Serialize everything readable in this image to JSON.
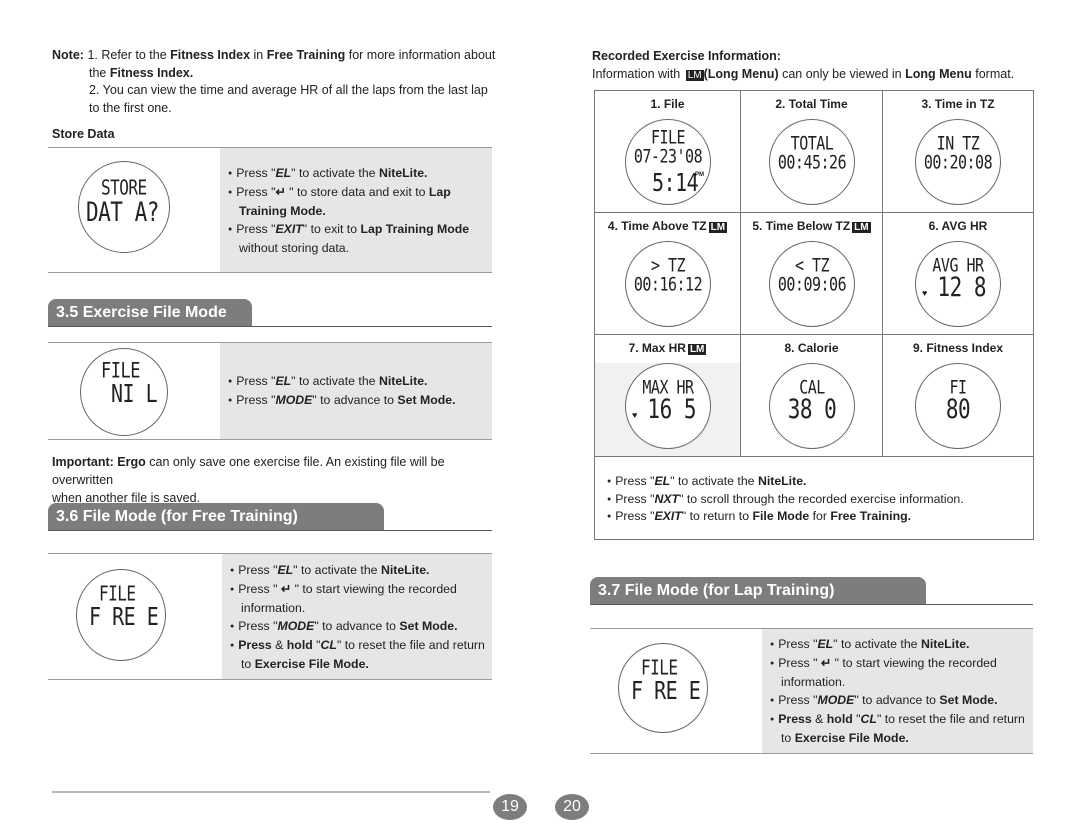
{
  "left_page": {
    "note": {
      "label": "Note:",
      "item1_prefix": "1. Refer to the",
      "item1_b1": "Fitness Index",
      "item1_mid": "in",
      "item1_b2": "Free Training",
      "item1_suffix": "for more information about",
      "item1_line2_pre": "the",
      "item1_line2_b": "Fitness Index.",
      "item2_line1": "2. You can view the time and average HR of all the laps from the last lap",
      "item2_line2": "to the first one."
    },
    "store_data": {
      "title": "Store Data",
      "watch": {
        "line1": "STORE",
        "line2": "DAT A?"
      },
      "bullets": [
        {
          "pre": "Press \"",
          "key": "EL",
          "mid": "\" to activate the ",
          "b": "NiteLite.",
          "post": ""
        },
        {
          "pre": "Press \"",
          "key": "↵",
          "mid": " \" to store data and exit to ",
          "b": "Lap",
          "post": ""
        },
        {
          "cont_b": "Training Mode."
        },
        {
          "pre": "Press \"",
          "key": "EXIT",
          "mid": "\" to exit to ",
          "b": "Lap Training Mode",
          "post": ""
        },
        {
          "cont": "without storing data."
        }
      ]
    },
    "section_35": {
      "title": "3.5 Exercise File Mode",
      "watch": {
        "line1": "FILE",
        "line2": "NI L"
      },
      "bullets": [
        {
          "pre": "Press \"",
          "key": "EL",
          "mid": "\" to activate the ",
          "b": "NiteLite."
        },
        {
          "pre": "Press \"",
          "key": "MODE",
          "mid": "\" to advance to ",
          "b": "Set Mode."
        }
      ]
    },
    "important": {
      "label": "Important:",
      "b": "Ergo",
      "text": "can only save one exercise file. An existing file will be overwritten",
      "line2": "when another file is saved."
    },
    "section_36": {
      "title": "3.6  File Mode (for Free Training)",
      "watch": {
        "line1": "FILE",
        "line2": "F RE E"
      },
      "bullets": [
        {
          "pre": "Press \"",
          "key": "EL",
          "mid": "\" to activate the ",
          "b": "NiteLite."
        },
        {
          "pre": "Press \" ",
          "key": "↵",
          "mid": " \" to start viewing the recorded",
          "b": ""
        },
        {
          "cont": "information."
        },
        {
          "pre": "Press \"",
          "key": "MODE",
          "mid": "\" to advance to ",
          "b": "Set Mode."
        },
        {
          "pre_b": "Press",
          "pre": " & ",
          "pre_b2": "hold",
          "q": " \"",
          "key": "CL",
          "mid": "\"  to reset the file and return"
        },
        {
          "cont_pre": "to ",
          "cont_b": "Exercise File Mode."
        }
      ]
    },
    "page_number": "19"
  },
  "right_page": {
    "recorded_title": "Recorded Exercise Information:",
    "info_pre": "Information with",
    "lm_badge": "LM",
    "info_b1": "(Long Menu)",
    "info_mid": "can only be viewed in",
    "info_b2": "Long Menu",
    "info_post": "format.",
    "cells": [
      {
        "caption": "1. File",
        "lm": false,
        "line1": "FILE",
        "line2": "07-23'08",
        "line3": "5:14",
        "pm": "PM"
      },
      {
        "caption": "2. Total Time",
        "lm": false,
        "line1": "TOTAL",
        "line2": "00:45:26"
      },
      {
        "caption": "3. Time in TZ",
        "lm": false,
        "line1": "IN TZ",
        "line2": "00:20:08"
      },
      {
        "caption": "4. Time Above TZ",
        "lm": true,
        "line1": "> TZ",
        "line2": "00:16:12"
      },
      {
        "caption": "5. Time Below TZ",
        "lm": true,
        "line1": "< TZ",
        "line2": "00:09:06"
      },
      {
        "caption": "6. AVG HR",
        "lm": false,
        "line1": "AVG HR",
        "line2": "12 8"
      },
      {
        "caption": "7. Max HR",
        "lm": true,
        "line1": "MAX HR",
        "line2": "16 5"
      },
      {
        "caption": "8. Calorie",
        "lm": false,
        "line1": "CAL",
        "line2": "38 0"
      },
      {
        "caption": "9. Fitness Index",
        "lm": false,
        "line1": "FI",
        "line2": "80"
      }
    ],
    "grid_bullets": [
      {
        "pre": "Press \"",
        "key": "EL",
        "mid": "\" to activate the ",
        "b": "NiteLite.",
        "post": ""
      },
      {
        "pre": "Press \"",
        "key": "NXT",
        "mid": "\" to scroll through the recorded exercise information.",
        "b": "",
        "post": ""
      },
      {
        "pre": "Press \"",
        "key": "EXIT",
        "mid": "\"  to return to ",
        "b": "File Mode",
        "post": " for ",
        "b2": "Free Training."
      }
    ],
    "section_37": {
      "title": "3.7  File Mode (for Lap Training)",
      "watch": {
        "line1": "FILE",
        "line2": "F RE E"
      },
      "bullets": [
        {
          "pre": "Press \"",
          "key": "EL",
          "mid": "\" to activate the ",
          "b": "NiteLite."
        },
        {
          "pre": "Press \" ",
          "key": "↵",
          "mid": " \" to start viewing the recorded",
          "b": ""
        },
        {
          "cont": "information."
        },
        {
          "pre": "Press \"",
          "key": "MODE",
          "mid": "\" to advance to ",
          "b": "Set Mode."
        },
        {
          "pre_b": "Press",
          "pre": " & ",
          "pre_b2": "hold",
          "q": " \"",
          "key": "CL",
          "mid": "\"  to reset the file and return"
        },
        {
          "cont_pre": "to ",
          "cont_b": "Exercise File Mode."
        }
      ]
    },
    "page_number": "20"
  }
}
